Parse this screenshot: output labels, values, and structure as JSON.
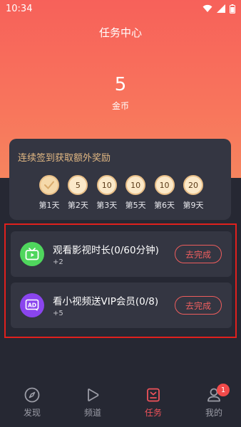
{
  "status_bar": {
    "time": "10:34",
    "icons": [
      "wifi-icon",
      "signal-icon",
      "battery-icon"
    ]
  },
  "header": {
    "title": "任务中心",
    "coin_value": "5",
    "coin_label": "金币"
  },
  "signin": {
    "title": "连续签到获取额外奖励",
    "days": [
      {
        "value": "",
        "label": "第1天",
        "done": true
      },
      {
        "value": "5",
        "label": "第2天"
      },
      {
        "value": "10",
        "label": "第3天"
      },
      {
        "value": "10",
        "label": "第5天"
      },
      {
        "value": "10",
        "label": "第6天"
      },
      {
        "value": "20",
        "label": "第9天"
      }
    ]
  },
  "tasks": [
    {
      "icon": "tv-play-icon",
      "name": "观看影视时长(0/60分钟)",
      "reward": "+2",
      "button": "去完成"
    },
    {
      "icon": "ad-icon",
      "name": "看小视频送VIP会员(0/8)",
      "reward": "+5",
      "button": "去完成"
    }
  ],
  "tabbar": {
    "items": [
      {
        "label": "发现",
        "icon": "compass-icon"
      },
      {
        "label": "频道",
        "icon": "play-icon"
      },
      {
        "label": "任务",
        "icon": "task-icon",
        "active": true
      },
      {
        "label": "我的",
        "icon": "user-icon",
        "badge": "1"
      }
    ]
  },
  "colors": {
    "accent": "#f0525a",
    "hero": "#f7615a",
    "background": "#262833",
    "card": "#343642",
    "gold": "#e2b883"
  }
}
